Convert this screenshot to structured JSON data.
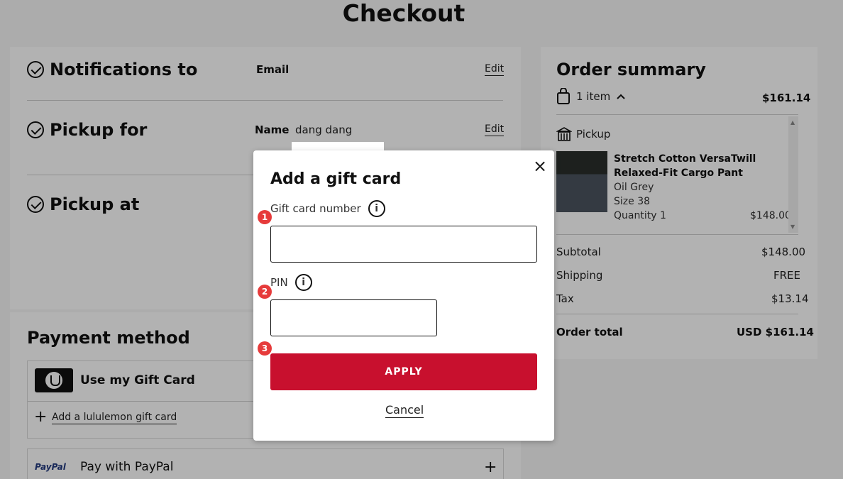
{
  "page": {
    "title": "Checkout"
  },
  "notifications": {
    "heading": "Notifications to",
    "email_label": "Email",
    "edit": "Edit"
  },
  "pickup_for": {
    "heading": "Pickup for",
    "name_label": "Name",
    "name_value": "dang dang",
    "edit": "Edit"
  },
  "pickup_at": {
    "heading": "Pickup at"
  },
  "payment": {
    "heading": "Payment method",
    "gift_card_option": "Use my Gift Card",
    "add_gift_card": "Add a lululemon gift card",
    "paypal_logo": "PayPal",
    "paypal_option": "Pay with PayPal"
  },
  "order_summary": {
    "title": "Order summary",
    "item_count": "1 item",
    "header_total": "$161.14",
    "pickup": "Pickup",
    "product_name": "Stretch Cotton VersaTwill Relaxed-Fit Cargo Pant",
    "color": "Oil Grey",
    "size": "Size 38",
    "quantity": "Quantity 1",
    "price": "$148.00",
    "subtotal_label": "Subtotal",
    "subtotal_value": "$148.00",
    "shipping_label": "Shipping",
    "shipping_value": "FREE",
    "tax_label": "Tax",
    "tax_value": "$13.14",
    "total_label": "Order total",
    "total_value": "USD $161.14"
  },
  "modal": {
    "title": "Add a gift card",
    "card_number_label": "Gift card number",
    "pin_label": "PIN",
    "apply": "APPLY",
    "cancel": "Cancel",
    "close_icon": "×",
    "info_icon": "i",
    "badges": [
      "1",
      "2",
      "3"
    ]
  }
}
